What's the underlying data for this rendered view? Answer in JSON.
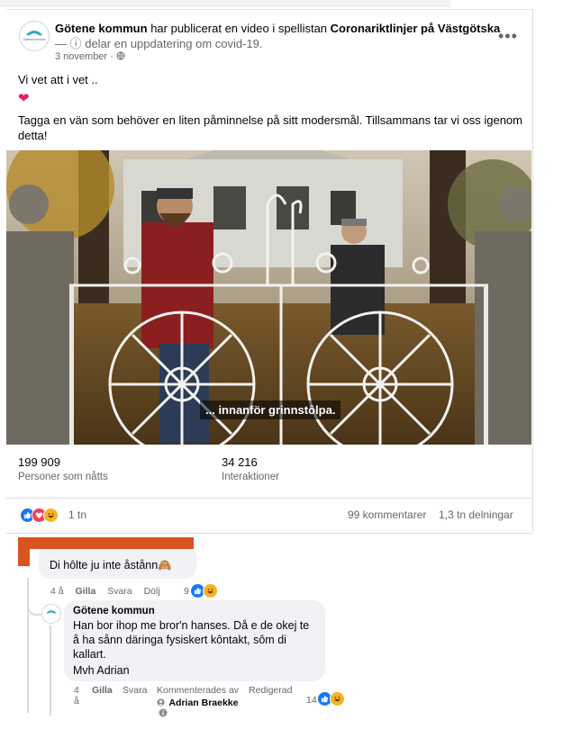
{
  "post": {
    "page_name": "Götene kommun",
    "header_mid": " har publicerat en video i spellistan ",
    "playlist": "Coronariktlinjer på Västgötska",
    "header_line2": "— ⓘ delar en uppdatering om covid-19.",
    "date": "3 november · ",
    "text_line1": "Vi vet att i vet ..",
    "heart": "❤",
    "text_line2": "Tagga en vän som behöver en liten påminnelse på sitt modersmål. Tillsammans tar vi oss igenom",
    "text_line3": "detta!",
    "logo_text": "Götene kommun"
  },
  "video": {
    "caption": "... innanför grinnstôlpa."
  },
  "stats": {
    "reach_value": "199 909",
    "reach_label": "Personer som nåtts",
    "interactions_value": "34 216",
    "interactions_label": "Interaktioner"
  },
  "footer": {
    "reactions_count": "1 tn",
    "comments": "99 kommentarer",
    "shares": "1,3 tn delningar"
  },
  "comment1": {
    "text": "Di hôlte ju inte åstånn🙈",
    "time": "4 å",
    "like": "Gilla",
    "reply": "Svara",
    "hide": "Dölj",
    "reactions": "9"
  },
  "reply1": {
    "author": "Götene kommun",
    "line1": "Han bor ihop me bror'n hanses. Då e de okej te",
    "line2": "å ha sånn däringa fysiskert kôntakt, sôm di",
    "line3": "kallart.",
    "line4": "Mvh Adrian",
    "time1": "4",
    "time2": "å",
    "like": "Gilla",
    "reply": "Svara",
    "commented_by": "Kommenterades av",
    "commenter": "Adrian Braekke",
    "edited": "Redigerad",
    "reactions": "14"
  },
  "colors": {
    "like_blue": "#1877f2",
    "love_red": "#f33e58",
    "haha_yellow": "#f7b125",
    "redaction_orange": "#d9531e",
    "muted_gray": "#65676b",
    "bubble_gray": "#f0f2f5"
  },
  "icons": [
    "globe-icon",
    "more-options-icon",
    "info-icon",
    "like-icon",
    "love-icon",
    "haha-icon"
  ]
}
